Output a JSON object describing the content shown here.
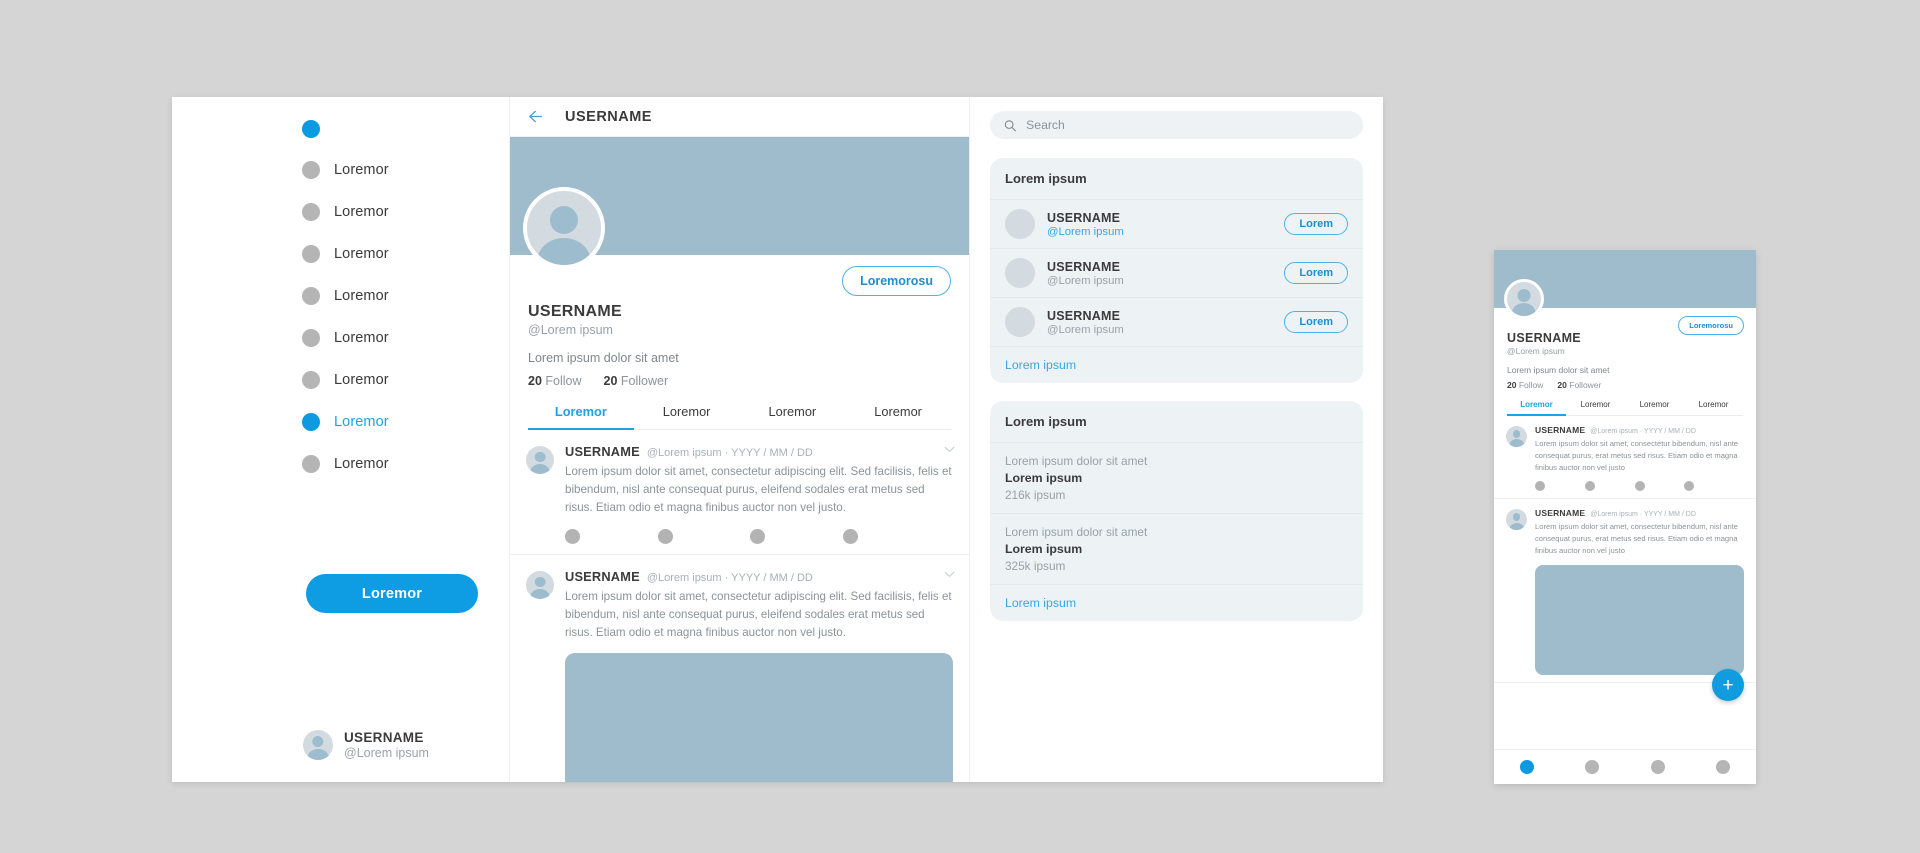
{
  "sidebar": {
    "items": [
      {
        "label": "",
        "active": true
      },
      {
        "label": "Loremor",
        "active": false
      },
      {
        "label": "Loremor",
        "active": false
      },
      {
        "label": "Loremor",
        "active": false
      },
      {
        "label": "Loremor",
        "active": false
      },
      {
        "label": "Loremor",
        "active": false
      },
      {
        "label": "Loremor",
        "active": false
      },
      {
        "label": "Loremor",
        "active": true
      },
      {
        "label": "Loremor",
        "active": false
      }
    ],
    "cta_label": "Loremor",
    "account": {
      "name": "USERNAME",
      "handle": "@Lorem ipsum"
    }
  },
  "profile": {
    "header_title": "USERNAME",
    "back_icon": "arrow-left-icon",
    "edit_button": "Loremorosu",
    "name": "USERNAME",
    "handle": "@Lorem ipsum",
    "bio": "Lorem ipsum dolor sit amet",
    "stats": [
      {
        "count": "20",
        "label": "Follow"
      },
      {
        "count": "20",
        "label": "Follower"
      }
    ],
    "tabs": [
      {
        "label": "Loremor",
        "active": true
      },
      {
        "label": "Loremor",
        "active": false
      },
      {
        "label": "Loremor",
        "active": false
      },
      {
        "label": "Loremor",
        "active": false
      }
    ],
    "posts": [
      {
        "user": "USERNAME",
        "meta": "@Lorem ipsum · YYYY / MM / DD",
        "text": "Lorem ipsum dolor sit amet, consectetur adipiscing elit. Sed facilisis, felis et bibendum, nisl ante consequat purus, eleifend sodales erat metus sed risus. Etiam odio et magna finibus auctor non vel justo.",
        "has_image": false
      },
      {
        "user": "USERNAME",
        "meta": "@Lorem ipsum · YYYY / MM / DD",
        "text": "Lorem ipsum dolor sit amet, consectetur adipiscing elit. Sed facilisis, felis et bibendum, nisl ante consequat purus, eleifend sodales erat metus sed risus. Etiam odio et magna finibus auctor non vel justo.",
        "has_image": true
      }
    ]
  },
  "rail": {
    "search": {
      "placeholder": "Search",
      "value": "",
      "icon": "search-icon"
    },
    "follow_card": {
      "title": "Lorem ipsum",
      "items": [
        {
          "name": "USERNAME",
          "handle": "@Lorem ipsum",
          "button": "Lorem",
          "handle_highlight": true
        },
        {
          "name": "USERNAME",
          "handle": "@Lorem ipsum",
          "button": "Lorem",
          "handle_highlight": false
        },
        {
          "name": "USERNAME",
          "handle": "@Lorem ipsum",
          "button": "Lorem",
          "handle_highlight": false
        }
      ],
      "more": "Lorem ipsum"
    },
    "trends_card": {
      "title": "Lorem ipsum",
      "items": [
        {
          "top": "Lorem ipsum dolor sit amet",
          "name": "Lorem ipsum",
          "count": "216k ipsum"
        },
        {
          "top": "Lorem ipsum dolor sit amet",
          "name": "Lorem ipsum",
          "count": "325k ipsum"
        }
      ],
      "more": "Lorem ipsum"
    }
  },
  "mobile": {
    "edit_button": "Loremorosu",
    "name": "USERNAME",
    "handle": "@Lorem ipsum",
    "bio": "Lorem ipsum dolor sit amet",
    "stats": [
      {
        "count": "20",
        "label": "Follow"
      },
      {
        "count": "20",
        "label": "Follower"
      }
    ],
    "tabs": [
      {
        "label": "Loremor",
        "active": true
      },
      {
        "label": "Loremor",
        "active": false
      },
      {
        "label": "Loremor",
        "active": false
      },
      {
        "label": "Loremor",
        "active": false
      }
    ],
    "posts": [
      {
        "user": "USERNAME",
        "meta": "@Lorem ipsum · YYYY / MM / DD",
        "text": "Lorem ipsum dolor sit amet, consectetur bibendum, nisl ante consequat purus, erat metus sed risus. Etiam odio et magna finibus auctor non vel justo",
        "has_image": false
      },
      {
        "user": "USERNAME",
        "meta": "@Lorem ipsum · YYYY / MM / DD",
        "text": "Lorem ipsum dolor sit amet, consectetur bibendum, nisl ante consequat purus, erat metus sed risus. Etiam odio et magna finibus auctor non vel justo",
        "has_image": true
      }
    ],
    "fab_label": "+",
    "nav_active_index": 0,
    "nav_count": 4
  },
  "colors": {
    "accent": "#0e9ce2",
    "accent_light": "#1ba3e6",
    "cover": "#9fbccd",
    "card_bg": "#edf2f5",
    "page_bg": "#d5d5d5"
  }
}
